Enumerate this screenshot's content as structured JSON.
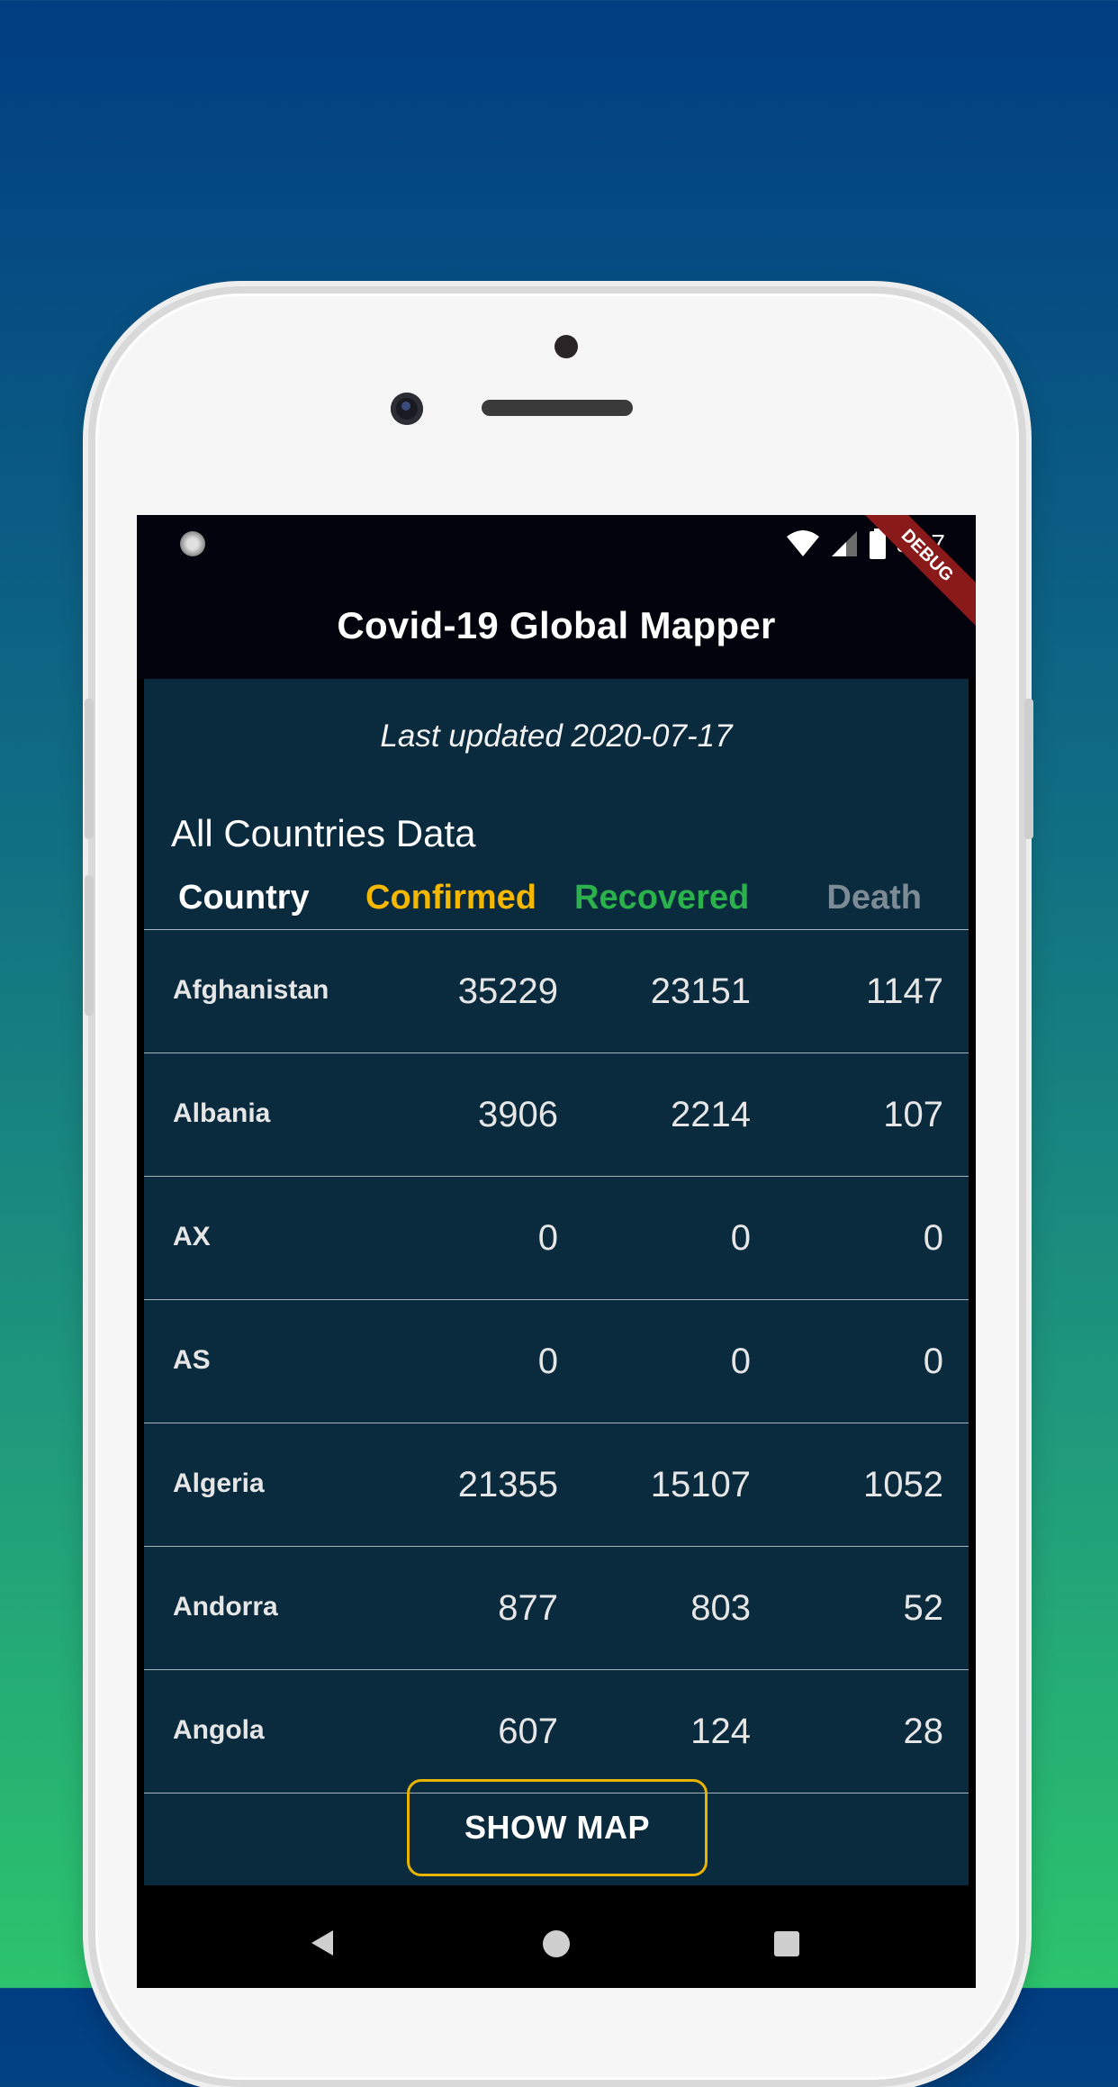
{
  "status_bar": {
    "time": "5:17"
  },
  "app_bar": {
    "title": "Covid-19 Global Mapper",
    "debug_label": "DEBUG"
  },
  "last_updated": "Last updated 2020-07-17",
  "section_title": "All Countries Data",
  "table": {
    "headers": [
      "Country",
      "Confirmed",
      "Recovered",
      "Death"
    ],
    "header_colors": [
      "#ffffff",
      "#f5b800",
      "#2bb24c",
      "#7d8b95"
    ],
    "rows": [
      {
        "country": "Afghanistan",
        "confirmed": "35229",
        "recovered": "23151",
        "death": "1147"
      },
      {
        "country": "Albania",
        "confirmed": "3906",
        "recovered": "2214",
        "death": "107"
      },
      {
        "country": "AX",
        "confirmed": "0",
        "recovered": "0",
        "death": "0"
      },
      {
        "country": "AS",
        "confirmed": "0",
        "recovered": "0",
        "death": "0"
      },
      {
        "country": "Algeria",
        "confirmed": "21355",
        "recovered": "15107",
        "death": "1052"
      },
      {
        "country": "Andorra",
        "confirmed": "877",
        "recovered": "803",
        "death": "52"
      },
      {
        "country": "Angola",
        "confirmed": "607",
        "recovered": "124",
        "death": "28"
      }
    ]
  },
  "show_map_button": "SHOW MAP",
  "nav_bar": {
    "icons": [
      "back-icon",
      "home-icon",
      "recents-icon"
    ]
  },
  "colors": {
    "background_top": "#013d82",
    "background_bottom": "#2cc46c",
    "panel": "#0a2a3e",
    "accent": "#e9b400"
  }
}
